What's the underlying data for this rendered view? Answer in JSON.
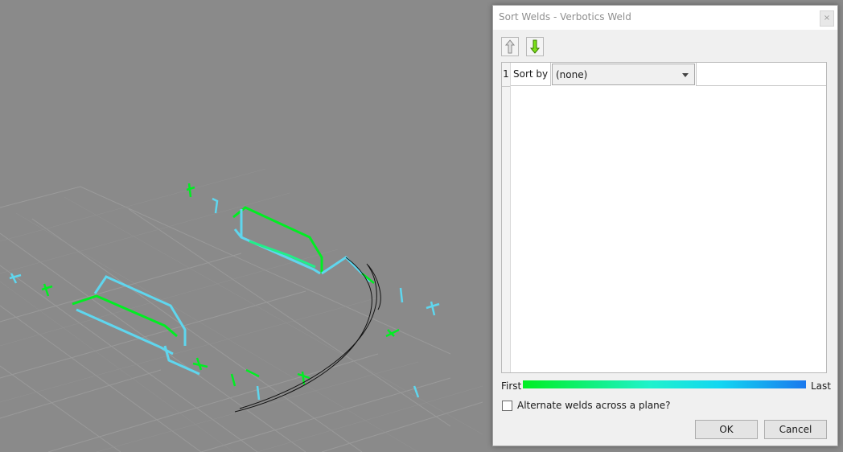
{
  "dialog": {
    "title": "Sort Welds - Verbotics Weld",
    "close_symbol": "×",
    "toolbar": {
      "move_up_icon": "arrow-up-icon",
      "move_down_icon": "arrow-down-icon"
    },
    "sort_table": {
      "rows": [
        {
          "index": "1",
          "label": "Sort by",
          "value": "(none)"
        }
      ]
    },
    "gradient": {
      "first_label": "First",
      "last_label": "Last",
      "colors": [
        "#00ee22",
        "#1ff2cc",
        "#12d6f2",
        "#1a78ee"
      ]
    },
    "alternate_checkbox": {
      "label": "Alternate welds across a plane?",
      "checked": false
    },
    "buttons": {
      "ok": "OK",
      "cancel": "Cancel"
    }
  },
  "viewport": {
    "background": "#8a8a8a",
    "grid_color": "#9a9a9a",
    "weld_colors": [
      "#00ee22",
      "#5fd6ee"
    ]
  }
}
